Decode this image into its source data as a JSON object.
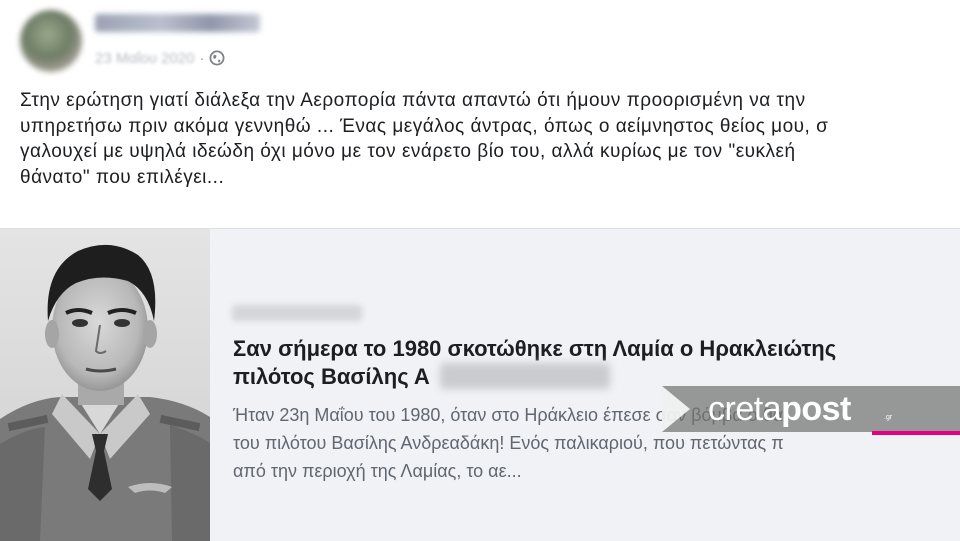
{
  "post": {
    "author_name": "Ελ Ανδρεαδάκη",
    "date": "23 Μαΐου 2020",
    "separator": "·",
    "audience_icon": "globe-icon",
    "text_lines": [
      "Στην ερώτηση γιατί διάλεξα την Αεροπορία πάντα απαντώ ότι ήμουν προορισμένη να την",
      "υπηρετήσω πριν ακόμα γεννηθώ ... Ένας μεγάλος άντρας, όπως ο αείμνηστος θείος μου, σ",
      "γαλουχεί με υψηλά ιδεώδη όχι μόνο με τον ενάρετο βίο του, αλλά κυρίως με τον \"ευκλεή",
      "θάνατο\" που επιλέγει..."
    ]
  },
  "link_preview": {
    "domain": "CRETAPOST.GR",
    "title_lines": [
      "Σαν σήμερα το 1980 σκοτώθηκε στη Λαμία ο Ηρακλειώτης",
      "πιλότος Βασίλης Α"
    ],
    "description_lines": [
      "Ήταν 23η Μαΐου του 1980, όταν στο Ηράκλειο έπεσε σαν βόμβα ο θά",
      "του πιλότου Βασίλης Ανδρεαδάκη! Ενός παλικαριού, που πετώντας π",
      "από την περιοχή της Λαμίας, το αε..."
    ],
    "photo_icon": "pilot-portrait"
  },
  "watermark": {
    "brand_light": "creta",
    "brand_bold": "post",
    "suffix": ".gr",
    "accent_color": "#e4007f"
  }
}
